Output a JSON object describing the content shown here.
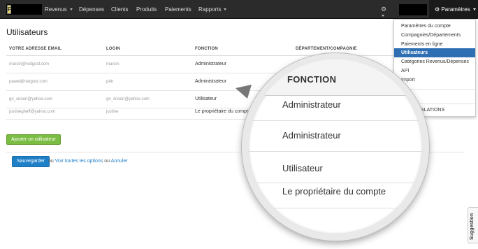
{
  "navbar": {
    "logo_letter": "F",
    "items": [
      {
        "label": "Revenus",
        "has_caret": true
      },
      {
        "label": "Dépenses",
        "has_caret": false
      },
      {
        "label": "Clients",
        "has_caret": false
      },
      {
        "label": "Produits",
        "has_caret": false
      },
      {
        "label": "Paiements",
        "has_caret": false
      },
      {
        "label": "Rapports",
        "has_caret": true
      }
    ],
    "settings_icon": "gear-icon",
    "params_label": "Paramètres"
  },
  "page": {
    "title": "Utilisateurs"
  },
  "table": {
    "headers": [
      "VOTRE ADRESSE EMAIL",
      "LOGIN",
      "FONCTION",
      "DÉPARTEMENT/COMPAGNIE"
    ],
    "rows": [
      {
        "email": "marcin@redgost.com",
        "login": "marcin",
        "function": "Administrateur"
      },
      {
        "email": "pawel@redgost.com",
        "login": "p4tr",
        "function": "Administrateur"
      },
      {
        "email": "gn_snoon@yahoo.com",
        "login": "gn_snoon@yahoo.com",
        "function": "Utilisateur"
      },
      {
        "email": "justinegheff@yahoo.com",
        "login": "justine",
        "function": "Le propriétaire du compte"
      }
    ]
  },
  "actions": {
    "add_user": "Ajouter un utilisateur",
    "save": "Sauvegarder",
    "or1": "ou",
    "see_all": "Voir toutes les options",
    "or2": "ou",
    "cancel": "Annuler"
  },
  "dropdown": {
    "items": [
      {
        "label": "Paramètres du compte",
        "active": false
      },
      {
        "label": "Compagnies/Départements",
        "active": false
      },
      {
        "label": "Paiements en ligne",
        "active": false
      },
      {
        "label": "Utilisateurs",
        "active": true
      },
      {
        "label": "Catégories Revenus/Dépenses",
        "active": false
      },
      {
        "label": "API",
        "active": false
      },
      {
        "label": "Import",
        "active": false
      }
    ],
    "partial_text": "NSLATIONS"
  },
  "magnifier": {
    "header": "FONCTION",
    "rows": [
      "Administrateur",
      "Administrateur",
      "Utilisateur",
      "Le propriétaire du compte"
    ]
  },
  "suggestion_tab": "Suggestion"
}
